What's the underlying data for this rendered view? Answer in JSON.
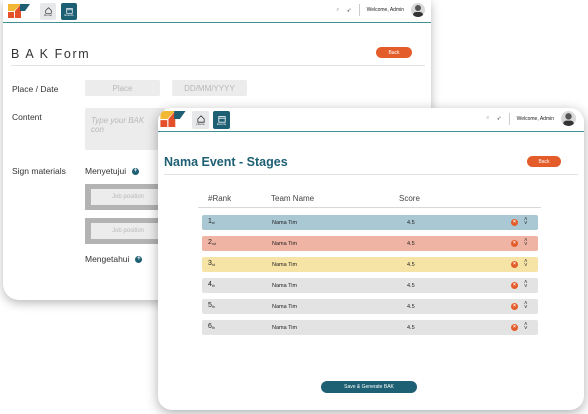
{
  "colors": {
    "brand_teal": "#1d5f73",
    "accent_orange": "#e35c2a",
    "logo_yellow": "#f3b833",
    "logo_red": "#e4502a",
    "row_rank_1": "#a9c8d4",
    "row_rank_2": "#f0b4a4",
    "row_rank_3": "#f6e3a6",
    "row_default": "#e3e3e3"
  },
  "header": {
    "nav": [
      {
        "label": "Home",
        "icon": "home-icon"
      },
      {
        "label": "Events",
        "icon": "calendar-icon"
      }
    ],
    "welcome_text": "Welcome, Admin"
  },
  "bak_form": {
    "title": "B A K  Form",
    "back_label": "Back",
    "place_date_label": "Place / Date",
    "place_placeholder": "Place",
    "date_placeholder": "DD/MM/YYYY",
    "content_label": "Content",
    "content_placeholder": "Type your BAK con",
    "sign_materials_label": "Sign materials",
    "approve_heading": "Menyetujui",
    "acknowledge_heading": "Mengetahui",
    "job_position_placeholder": "Job position"
  },
  "stages": {
    "title": "Nama Event - Stages",
    "back_label": "Back",
    "columns": [
      "#Rank",
      "Team Name",
      "Score"
    ],
    "rows": [
      {
        "rank": "1",
        "suffix": "st",
        "team": "Nama Tim",
        "score": "4.5"
      },
      {
        "rank": "2",
        "suffix": "nd",
        "team": "Nama Tim",
        "score": "4.5"
      },
      {
        "rank": "3",
        "suffix": "rd",
        "team": "Nama Tim",
        "score": "4.5"
      },
      {
        "rank": "4",
        "suffix": "th",
        "team": "Nama Tim",
        "score": "4.5"
      },
      {
        "rank": "5",
        "suffix": "th",
        "team": "Nama Tim",
        "score": "4.5"
      },
      {
        "rank": "6",
        "suffix": "th",
        "team": "Nama Tim",
        "score": "4.5"
      }
    ],
    "save_label": "Save & Generate BAK"
  }
}
